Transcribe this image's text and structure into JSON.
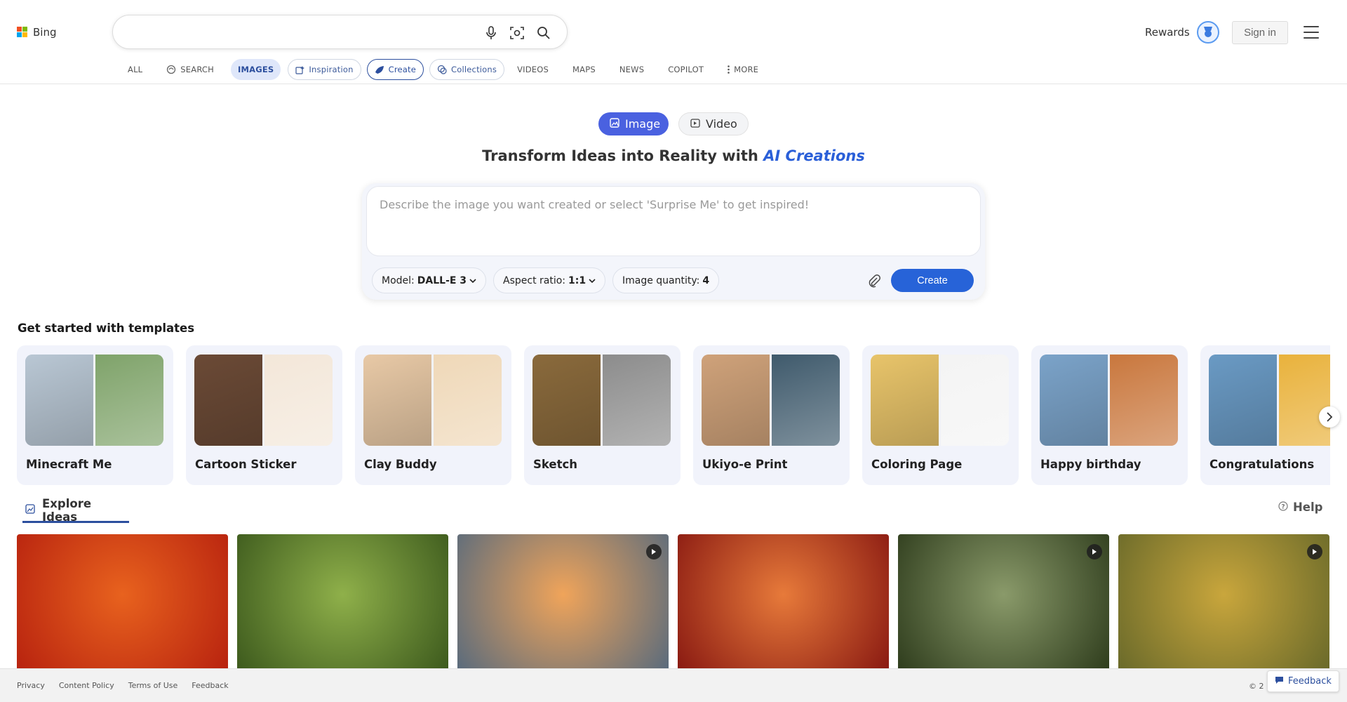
{
  "header": {
    "brand": "Bing",
    "search_placeholder": "",
    "rewards_label": "Rewards",
    "signin_label": "Sign in"
  },
  "nav": {
    "all": "ALL",
    "search": "SEARCH",
    "images": "IMAGES",
    "inspiration": "Inspiration",
    "create": "Create",
    "collections": "Collections",
    "videos": "VIDEOS",
    "maps": "MAPS",
    "news": "NEWS",
    "copilot": "COPILOT",
    "more": "MORE"
  },
  "mode": {
    "image": "Image",
    "video": "Video"
  },
  "hero": {
    "title_plain": "Transform Ideas into Reality with ",
    "title_emphasis": "AI Creations"
  },
  "prompt": {
    "placeholder": "Describe the image you want created or select 'Surprise Me' to get inspired!",
    "model_label": "Model:",
    "model_value": "DALL-E 3",
    "aspect_label": "Aspect ratio:",
    "aspect_value": "1:1",
    "quantity_label": "Image quantity:",
    "quantity_value": "4",
    "create_label": "Create"
  },
  "templates": {
    "title": "Get started with templates",
    "items": [
      {
        "label": "Minecraft Me",
        "colors": [
          "#b9c7d4",
          "#7fa36a"
        ]
      },
      {
        "label": "Cartoon Sticker",
        "colors": [
          "#6b4a36",
          "#f3e7d9"
        ]
      },
      {
        "label": "Clay Buddy",
        "colors": [
          "#e8c9a6",
          "#efd8b8"
        ]
      },
      {
        "label": "Sketch",
        "colors": [
          "#8a6a3c",
          "#8c8c8c"
        ]
      },
      {
        "label": "Ukiyo-e Print",
        "colors": [
          "#cfa27a",
          "#3f5a6c"
        ]
      },
      {
        "label": "Coloring Page",
        "colors": [
          "#e8c46a",
          "#f4f4f4"
        ]
      },
      {
        "label": "Happy birthday",
        "colors": [
          "#7ba3c9",
          "#c9773d"
        ]
      },
      {
        "label": "Congratulations",
        "colors": [
          "#6a9ac4",
          "#e9b23c"
        ]
      }
    ]
  },
  "explore": {
    "tab_label": "Explore Ideas",
    "help_label": "Help",
    "images": [
      {
        "name": "lunar-horse",
        "colors": [
          "#b8230f",
          "#e8621e"
        ],
        "video": false
      },
      {
        "name": "forest-light",
        "colors": [
          "#3d5a1d",
          "#8fb04a"
        ],
        "video": false
      },
      {
        "name": "space-needle",
        "colors": [
          "#5a6b7c",
          "#f0a45a"
        ],
        "video": true
      },
      {
        "name": "anime-girl",
        "colors": [
          "#8a1a12",
          "#e77a3a"
        ],
        "video": false
      },
      {
        "name": "bench-aerial",
        "colors": [
          "#2f3d1d",
          "#8a9a6a"
        ],
        "video": true
      },
      {
        "name": "capybara",
        "colors": [
          "#6a6a2a",
          "#c9a63c"
        ],
        "video": true
      }
    ]
  },
  "footer": {
    "links": [
      "Privacy",
      "Content Policy",
      "Terms of Use",
      "Feedback"
    ],
    "copyright": "© 2",
    "feedback_button": "Feedback"
  }
}
